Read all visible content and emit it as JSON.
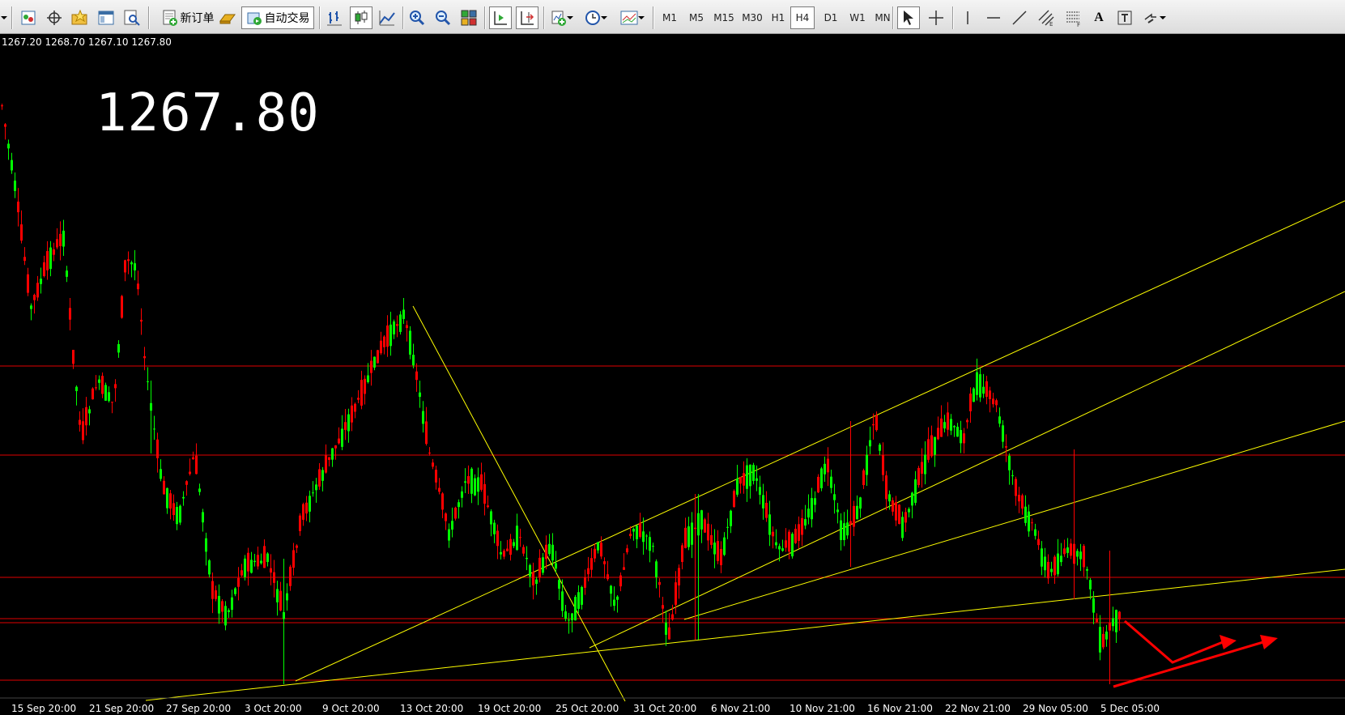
{
  "toolbar": {
    "new_order_label": "新订单",
    "auto_trade_label": "自动交易",
    "timeframes": [
      "M1",
      "M5",
      "M15",
      "M30",
      "H1",
      "H4",
      "D1",
      "W1",
      "MN"
    ],
    "active_timeframe": "H4",
    "text_tool_label": "A"
  },
  "chart": {
    "ohlc_text": "1267.20 1268.70 1267.10 1267.80",
    "big_price": "1267.80",
    "x_labels": [
      "15 Sep 20:00",
      "21 Sep 20:00",
      "27 Sep 20:00",
      "3 Oct 20:00",
      "9 Oct 20:00",
      "13 Oct 20:00",
      "19 Oct 20:00",
      "25 Oct 20:00",
      "31 Oct 20:00",
      "6 Nov 21:00",
      "10 Nov 21:00",
      "16 Nov 21:00",
      "22 Nov 21:00",
      "29 Nov 05:00",
      "5 Dec 05:00"
    ],
    "colors": {
      "bull": "#00ff00",
      "bear": "#ff0000",
      "level": "#e00000",
      "trend": "#ffff00",
      "arrow": "#ff0000",
      "background": "#000000"
    }
  }
}
